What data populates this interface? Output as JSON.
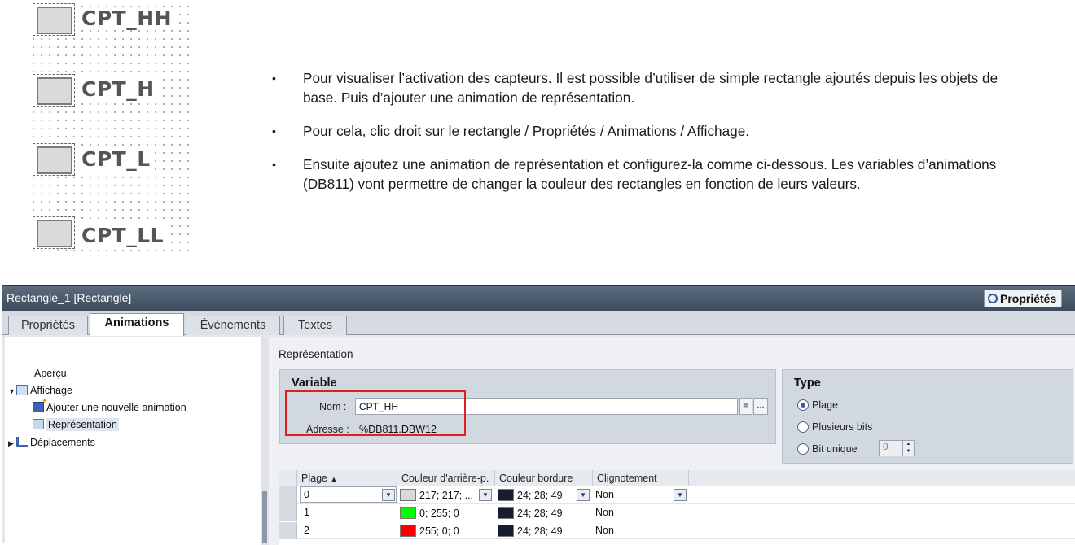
{
  "sensors": [
    "CPT_HH",
    "CPT_H",
    "CPT_L",
    "CPT_LL"
  ],
  "bullets": [
    "Pour visualiser l’activation des capteurs. Il est possible d’utiliser de simple rectangle ajoutés depuis les objets de base. Puis d’ajouter une animation de représentation.",
    "Pour cela, clic droit sur le rectangle / Propriétés / Animations / Affichage.",
    "Ensuite ajoutez une animation de représentation et configurez-la comme ci-dessous. Les variables d’animations (DB811) vont permettre de changer la couleur des rectangles en fonction de leurs valeurs."
  ],
  "bullet_symbol": "•",
  "panel": {
    "title": "Rectangle_1 [Rectangle]",
    "props_button": "Propriétés",
    "tabs": [
      "Propriétés",
      "Animations",
      "Événements",
      "Textes"
    ],
    "active_tab": "Animations",
    "tree": {
      "apercu": "Aperçu",
      "affichage": "Affichage",
      "ajouter": "Ajouter une nouvelle animation",
      "representation": "Représentation",
      "deplacements": "Déplacements"
    },
    "section_title": "Représentation",
    "variable": {
      "title": "Variable",
      "nom_label": "Nom :",
      "nom_value": "CPT_HH",
      "adresse_label": "Adresse :",
      "adresse_value": "%DB811.DBW12",
      "more_button": "..."
    },
    "type": {
      "title": "Type",
      "options": [
        "Plage",
        "Plusieurs bits",
        "Bit unique"
      ],
      "selected": "Plage",
      "bit_value": "0"
    },
    "table": {
      "headers": [
        "Plage",
        "Couleur d'arrière-p.",
        "Couleur bordure",
        "Clignotement"
      ],
      "sort_indicator": "▲",
      "rows": [
        {
          "plage": "0",
          "bg_text": "217; 217; ...",
          "bg_color": "#d9d9d9",
          "border_text": "24; 28; 49",
          "border_color": "#181c31",
          "blink": "Non"
        },
        {
          "plage": "1",
          "bg_text": "0; 255; 0",
          "bg_color": "#00ff00",
          "border_text": "24; 28; 49",
          "border_color": "#181c31",
          "blink": "Non"
        },
        {
          "plage": "2",
          "bg_text": "255; 0; 0",
          "bg_color": "#ff0000",
          "border_text": "24; 28; 49",
          "border_color": "#181c31",
          "blink": "Non"
        }
      ]
    }
  },
  "colors": {
    "highlight": "#e02020",
    "radio_selected": "#2f61b6"
  }
}
